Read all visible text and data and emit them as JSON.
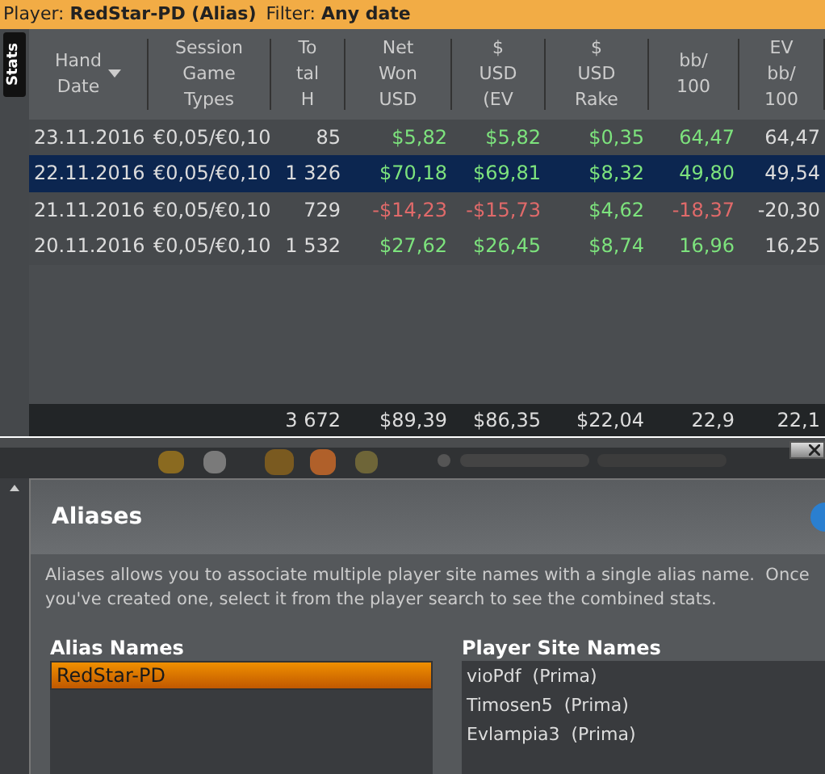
{
  "filter_bar": {
    "player_label": "Player:",
    "player_value": "RedStar-PD (Alias)",
    "filter_label": "Filter:",
    "filter_value": "Any date"
  },
  "side_tab": {
    "label": "Stats",
    "selected": true
  },
  "table": {
    "columns": [
      {
        "lines": [
          "Hand",
          "Date"
        ],
        "sorted": true
      },
      {
        "lines": [
          "Session",
          "Game",
          "Types"
        ],
        "sorted": false
      },
      {
        "lines": [
          "To",
          "tal",
          "H"
        ],
        "sorted": false
      },
      {
        "lines": [
          "Net",
          "Won",
          "USD"
        ],
        "sorted": false
      },
      {
        "lines": [
          "$",
          "USD",
          "(EV"
        ],
        "sorted": false
      },
      {
        "lines": [
          "$",
          "USD",
          "Rake"
        ],
        "sorted": false
      },
      {
        "lines": [
          "bb/",
          "100"
        ],
        "sorted": false
      },
      {
        "lines": [
          "EV",
          "bb/",
          "100"
        ],
        "sorted": false
      }
    ],
    "rows": [
      {
        "selected": false,
        "cells": [
          {
            "text": "23.11.2016",
            "color": "#dcdcdc"
          },
          {
            "text": "€0,05/€0,10",
            "color": "#dcdcdc"
          },
          {
            "text": "85",
            "color": "#dcdcdc"
          },
          {
            "text": "$5,82",
            "color": "#7de37d"
          },
          {
            "text": "$5,82",
            "color": "#7de37d"
          },
          {
            "text": "$0,35",
            "color": "#7de37d"
          },
          {
            "text": "64,47",
            "color": "#7de37d"
          },
          {
            "text": "64,47",
            "color": "#dcdcdc"
          }
        ]
      },
      {
        "selected": true,
        "cells": [
          {
            "text": "22.11.2016",
            "color": "#dcdcdc"
          },
          {
            "text": "€0,05/€0,10",
            "color": "#dcdcdc"
          },
          {
            "text": "1 326",
            "color": "#dcdcdc"
          },
          {
            "text": "$70,18",
            "color": "#7de37d"
          },
          {
            "text": "$69,81",
            "color": "#7de37d"
          },
          {
            "text": "$8,32",
            "color": "#7de37d"
          },
          {
            "text": "49,80",
            "color": "#7de37d"
          },
          {
            "text": "49,54",
            "color": "#dcdcdc"
          }
        ]
      },
      {
        "selected": false,
        "cells": [
          {
            "text": "21.11.2016",
            "color": "#dcdcdc"
          },
          {
            "text": "€0,05/€0,10",
            "color": "#dcdcdc"
          },
          {
            "text": "729",
            "color": "#dcdcdc"
          },
          {
            "text": "-$14,23",
            "color": "#e06a6a"
          },
          {
            "text": "-$15,73",
            "color": "#e06a6a"
          },
          {
            "text": "$4,62",
            "color": "#7de37d"
          },
          {
            "text": "-18,37",
            "color": "#e06a6a"
          },
          {
            "text": "-20,30",
            "color": "#dcdcdc"
          }
        ]
      },
      {
        "selected": false,
        "cells": [
          {
            "text": "20.11.2016",
            "color": "#dcdcdc"
          },
          {
            "text": "€0,05/€0,10",
            "color": "#dcdcdc"
          },
          {
            "text": "1 532",
            "color": "#dcdcdc"
          },
          {
            "text": "$27,62",
            "color": "#7de37d"
          },
          {
            "text": "$26,45",
            "color": "#7de37d"
          },
          {
            "text": "$8,74",
            "color": "#7de37d"
          },
          {
            "text": "16,96",
            "color": "#7de37d"
          },
          {
            "text": "16,25",
            "color": "#dcdcdc"
          }
        ]
      }
    ],
    "totals": [
      "3 672",
      "$89,39",
      "$86,35",
      "$22,04",
      "22,9",
      "22,1"
    ]
  },
  "aliases": {
    "title": "Aliases",
    "description": "Aliases allows you to associate multiple player site names with a single alias name.  Once you've created one, select it from the player search to see the combined stats.",
    "alias_names": {
      "heading": "Alias Names",
      "items": [
        {
          "label": "RedStar-PD",
          "selected": true
        }
      ]
    },
    "site_names": {
      "heading": "Player Site Names",
      "items": [
        {
          "label": "vioPdf  (Prima)",
          "selected": false
        },
        {
          "label": "Timosen5  (Prima)",
          "selected": false
        },
        {
          "label": "Evlampia3  (Prima)",
          "selected": false
        }
      ]
    }
  }
}
